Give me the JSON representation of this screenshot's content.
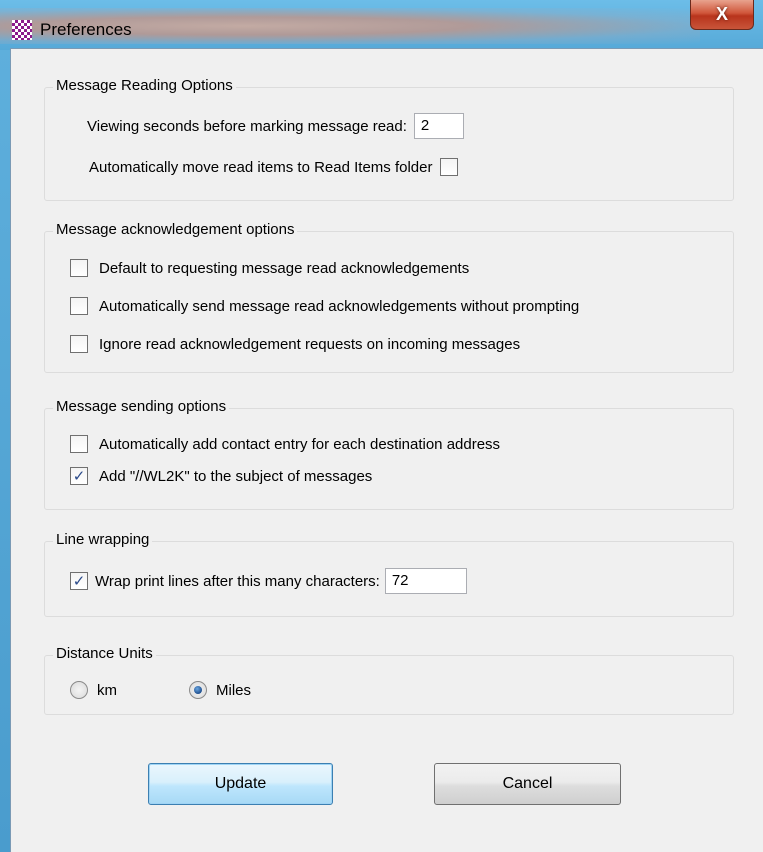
{
  "window": {
    "title": "Preferences",
    "close_label": "X"
  },
  "reading": {
    "title": "Message Reading Options",
    "seconds_label": "Viewing seconds before marking message read:",
    "seconds_value": "2",
    "move_label": "Automatically move read items to Read Items folder",
    "move_checked": false
  },
  "ack": {
    "title": "Message acknowledgement options",
    "items": [
      {
        "label": "Default to requesting message read acknowledgements",
        "checked": false
      },
      {
        "label": "Automatically send message read acknowledgements without prompting",
        "checked": false
      },
      {
        "label": "Ignore read acknowledgement requests on incoming messages",
        "checked": false
      }
    ]
  },
  "sending": {
    "title": "Message sending options",
    "items": [
      {
        "label": "Automatically add contact entry for each destination address",
        "checked": false
      },
      {
        "label": "Add \"//WL2K\" to the subject of messages",
        "checked": true
      }
    ]
  },
  "wrapping": {
    "title": "Line wrapping",
    "label": "Wrap print lines after this many characters:",
    "checked": true,
    "value": "72"
  },
  "units": {
    "title": "Distance Units",
    "options": [
      {
        "label": "km",
        "selected": false
      },
      {
        "label": "Miles",
        "selected": true
      }
    ]
  },
  "buttons": {
    "update": "Update",
    "cancel": "Cancel"
  },
  "colors": {
    "accent": "#3c7fb1",
    "close": "#c9553a",
    "dialog_bg": "#f0f0f0"
  }
}
